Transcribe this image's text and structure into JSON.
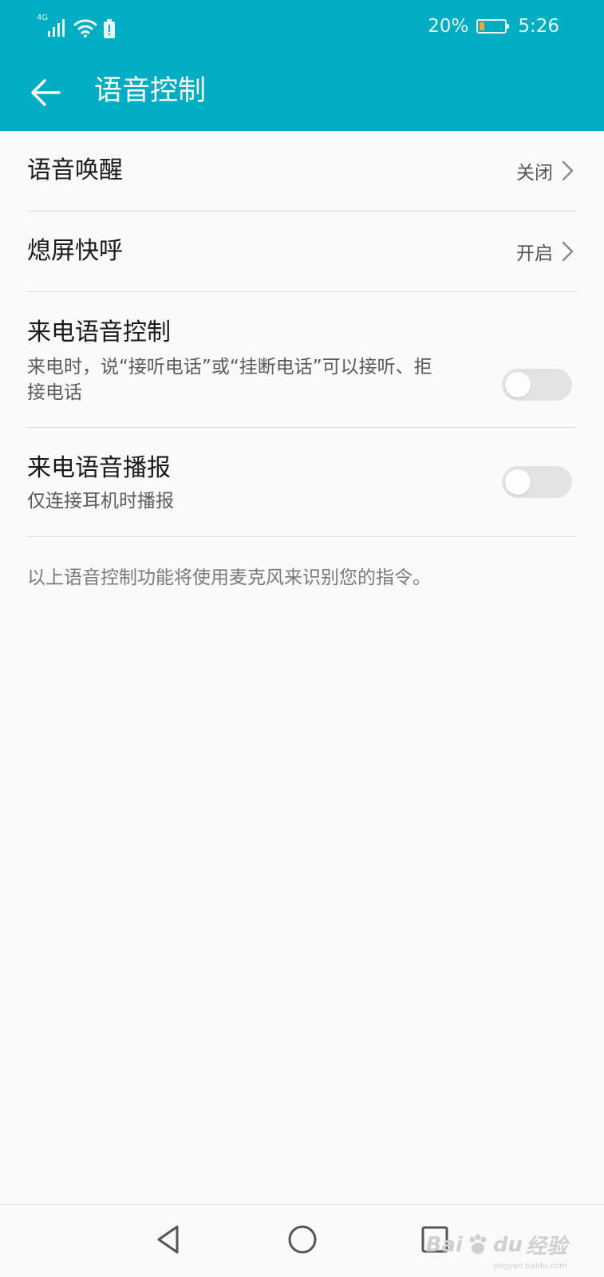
{
  "status_bar": {
    "network": "4G",
    "battery_percent": "20%",
    "battery_level": 0.2,
    "time": "5:26",
    "icons": [
      "signal-icon",
      "wifi-icon",
      "battery-alert-icon",
      "battery-icon"
    ]
  },
  "header": {
    "title": "语音控制",
    "back_icon": "arrow-left-icon",
    "color": "#00adc2"
  },
  "settings": {
    "voice_wakeup": {
      "title": "语音唤醒",
      "value": "关闭"
    },
    "screen_off_call": {
      "title": "熄屏快呼",
      "value": "开启"
    },
    "call_voice_control": {
      "title": "来电语音控制",
      "subtitle": "来电时，说“接听电话”或“挂断电话”可以接听、拒接电话",
      "enabled": false
    },
    "call_voice_announce": {
      "title": "来电语音播报",
      "subtitle": "仅连接耳机时播报",
      "enabled": false
    }
  },
  "footnote": "以上语音控制功能将使用麦克风来识别您的指令。",
  "nav_bar": {
    "back_icon": "triangle-back-icon",
    "home_icon": "circle-home-icon",
    "recent_icon": "square-recents-icon"
  },
  "watermark": {
    "brand": "Bai",
    "brand2": "du",
    "label": "经验",
    "url": "jingyan.baidu.com"
  }
}
